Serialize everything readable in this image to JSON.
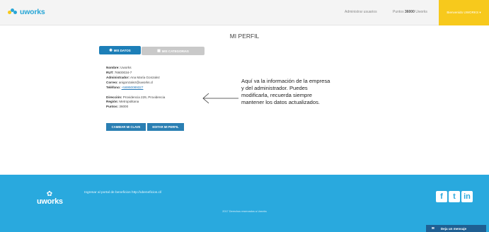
{
  "header": {
    "logo_text": "uworks",
    "admin_users": "Administrar usuarios",
    "points_prefix": "Puntos",
    "points_value": "36000",
    "points_suffix": "Uworks",
    "welcome": "Bienvenido UWORKS ▾"
  },
  "main": {
    "title": "MI PERFIL",
    "tabs": [
      {
        "label": "MIS DATOS",
        "icon": "user-icon"
      },
      {
        "label": "MIS CATEGORIAS",
        "icon": "briefcase-icon"
      }
    ],
    "info": {
      "nombre_label": "Nombre:",
      "nombre": "Uworks",
      "rut_label": "RUT:",
      "rut": "76600034-7",
      "admin_label": "Administrador:",
      "admin": "Ana María Gonzalez",
      "correo_label": "Correo:",
      "correo": "anigonzalez@uworks.cl",
      "telefono_label": "Teléfono:",
      "telefono": "+56950089327",
      "direccion_label": "Dirección:",
      "direccion": "Providencia 229, Providencia",
      "region_label": "Región:",
      "region": "Metropolitana",
      "puntos_label": "Puntos:",
      "puntos": "36000"
    },
    "buttons": {
      "change_password": "CAMBIAR MI CLAVE",
      "edit_profile": "EDITAR MI PERFIL"
    },
    "annotation": "Aquí va la información de la empresa y del administrador. Puedes modificarla, recuerda siempre mantener los datos actualizados."
  },
  "footer": {
    "logo_text": "uworks",
    "portal_link": "Ingresar al portal de beneficios http://ubeneficios.cl/",
    "copyright": "2017 Derechos reservados a Uworks",
    "social": [
      "f",
      "t",
      "in"
    ],
    "message_button": "Deja un mensaje"
  },
  "colors": {
    "brand_blue": "#28a6d6",
    "accent_yellow": "#f7c91c",
    "button_blue": "#2a7fb3"
  }
}
